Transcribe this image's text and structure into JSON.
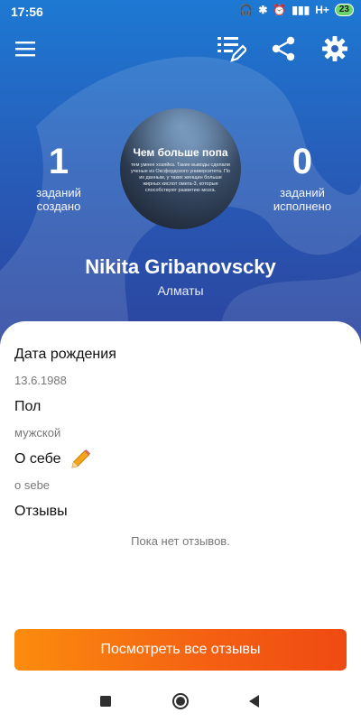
{
  "status_bar": {
    "time": "17:56",
    "network": "H+",
    "battery": "23"
  },
  "toolbar": {
    "menu_icon": "hamburger-menu-icon",
    "tasks_icon": "edit-list-icon",
    "share_icon": "share-icon",
    "settings_icon": "gear-icon"
  },
  "stats": {
    "created_count": "1",
    "created_label": "заданий создано",
    "completed_count": "0",
    "completed_label": "заданий исполнено"
  },
  "avatar": {
    "headline": "Чем больше попа",
    "caption": "тем умнее хозяйка. Такие выводы сделали ученые из Оксфордского университета. По их данным, у таких женщин больше жирных кислот омега-3, которые способствуют развитию мозга."
  },
  "profile": {
    "name": "Nikita Gribanovscky",
    "city": "Алматы"
  },
  "details": {
    "birthdate_title": "Дата рождения",
    "birthdate_value": "13.6.1988",
    "gender_title": "Пол",
    "gender_value": "мужской",
    "about_title": "О себе",
    "about_value": "o sebe",
    "reviews_title": "Отзывы",
    "reviews_empty": "Пока нет отзывов."
  },
  "cta": {
    "label": "Посмотреть все отзывы"
  },
  "colors": {
    "header_top": "#1d79d3",
    "header_bottom": "#2d3f99",
    "accent_start": "#fb8c0e",
    "accent_end": "#ef4a12",
    "pencil": "#f4a51c"
  }
}
